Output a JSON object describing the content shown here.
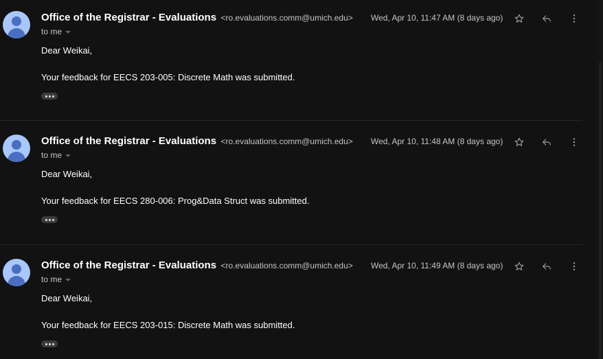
{
  "messages": [
    {
      "sender_name": "Office of the Registrar - Evaluations",
      "sender_email": "<ro.evaluations.comm@umich.edu>",
      "recipient": "to me",
      "date": "Wed, Apr 10, 11:47 AM (8 days ago)",
      "greeting": "Dear Weikai,",
      "body": "Your feedback for EECS 203-005: Discrete Math was submitted."
    },
    {
      "sender_name": "Office of the Registrar - Evaluations",
      "sender_email": "<ro.evaluations.comm@umich.edu>",
      "recipient": "to me",
      "date": "Wed, Apr 10, 11:48 AM (8 days ago)",
      "greeting": "Dear Weikai,",
      "body": "Your feedback for EECS 280-006: Prog&Data Struct was submitted."
    },
    {
      "sender_name": "Office of the Registrar - Evaluations",
      "sender_email": "<ro.evaluations.comm@umich.edu>",
      "recipient": "to me",
      "date": "Wed, Apr 10, 11:49 AM (8 days ago)",
      "greeting": "Dear Weikai,",
      "body": "Your feedback for EECS 203-015: Discrete Math was submitted."
    }
  ],
  "icons": {
    "avatar": "person-avatar-icon",
    "star": "star-outline-icon",
    "reply": "reply-icon",
    "more": "more-vert-icon",
    "trimmed": "ellipsis-icon"
  },
  "colors": {
    "background": "#121212",
    "avatar_bg": "#a8c7fa",
    "avatar_fg": "#4a6fc2",
    "text_primary": "#ffffff",
    "text_secondary": "#c4c7c5"
  }
}
